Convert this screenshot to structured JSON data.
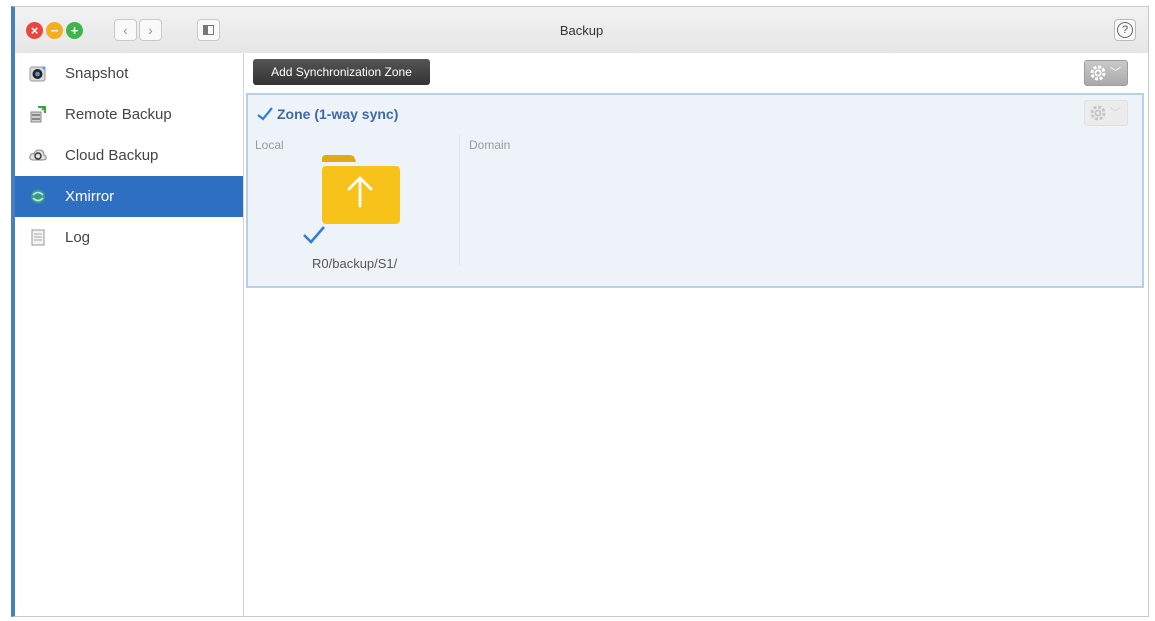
{
  "window": {
    "title": "Backup"
  },
  "titlebar": {
    "back_glyph": "‹",
    "forward_glyph": "›",
    "help_glyph": "?"
  },
  "sidebar": {
    "items": [
      {
        "label": "Snapshot",
        "icon": "snapshot-icon"
      },
      {
        "label": "Remote Backup",
        "icon": "remote-backup-icon"
      },
      {
        "label": "Cloud Backup",
        "icon": "cloud-backup-icon"
      },
      {
        "label": "Xmirror",
        "icon": "xmirror-icon",
        "active": true
      },
      {
        "label": "Log",
        "icon": "log-icon"
      }
    ]
  },
  "toolbar": {
    "add_zone_label": "Add Synchronization Zone",
    "settings_icon": "gear-icon"
  },
  "zone": {
    "title": "Zone (1-way sync)",
    "local_label": "Local",
    "domain_label": "Domain",
    "folder_path": "R0/backup/S1/"
  },
  "colors": {
    "accent": "#2f6fc1",
    "zone_title": "#3e6aa3",
    "zone_background": "#eef3f9",
    "folder": "#f7c21a",
    "check": "#2e7fd6"
  }
}
